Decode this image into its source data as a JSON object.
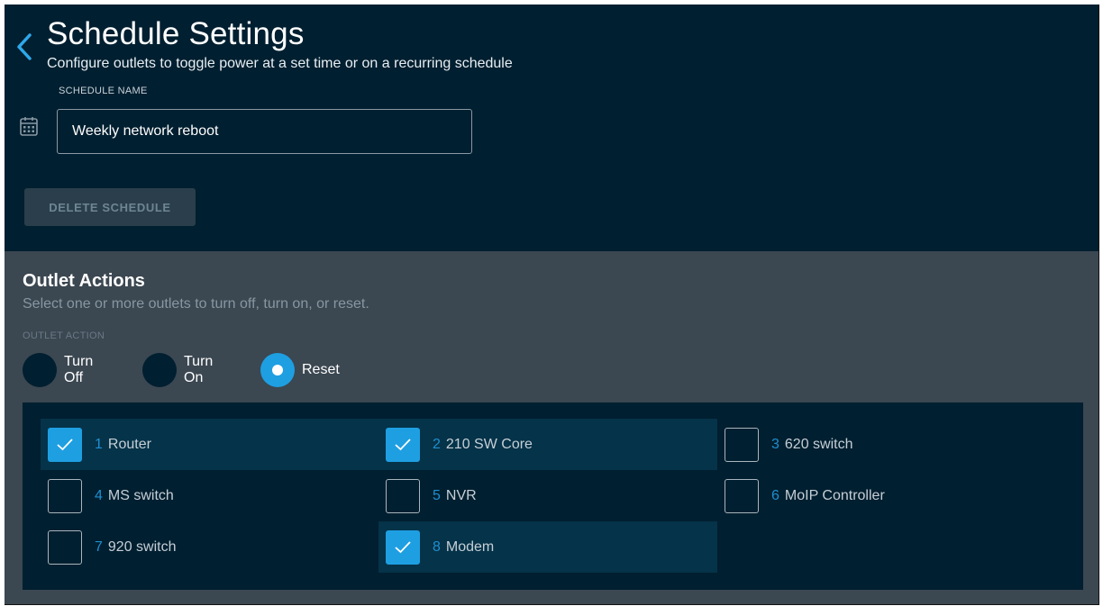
{
  "header": {
    "title": "Schedule Settings",
    "subtitle": "Configure outlets to toggle power at a set time or on a recurring schedule"
  },
  "schedule_name": {
    "label": "SCHEDULE NAME",
    "value": "Weekly network reboot"
  },
  "delete_button_label": "DELETE SCHEDULE",
  "outlet_actions": {
    "title": "Outlet Actions",
    "subtitle": "Select one or more outlets to turn off, turn on, or reset.",
    "action_label": "OUTLET ACTION",
    "options": [
      {
        "label": "Turn Off",
        "selected": false
      },
      {
        "label": "Turn On",
        "selected": false
      },
      {
        "label": "Reset",
        "selected": true
      }
    ]
  },
  "outlets": [
    {
      "num": "1",
      "name": "Router",
      "checked": true
    },
    {
      "num": "2",
      "name": "210 SW Core",
      "checked": true
    },
    {
      "num": "3",
      "name": "620 switch",
      "checked": false
    },
    {
      "num": "4",
      "name": "MS switch",
      "checked": false
    },
    {
      "num": "5",
      "name": "NVR",
      "checked": false
    },
    {
      "num": "6",
      "name": "MoIP Controller",
      "checked": false
    },
    {
      "num": "7",
      "name": "920 switch",
      "checked": false
    },
    {
      "num": "8",
      "name": "Modem",
      "checked": true
    }
  ],
  "colors": {
    "accent": "#1e9fe2",
    "background": "#001f30",
    "panel": "#3b4751",
    "selected_row": "#053349"
  },
  "icons": [
    "back-chevron-icon",
    "calendar-icon",
    "checkmark-icon"
  ]
}
